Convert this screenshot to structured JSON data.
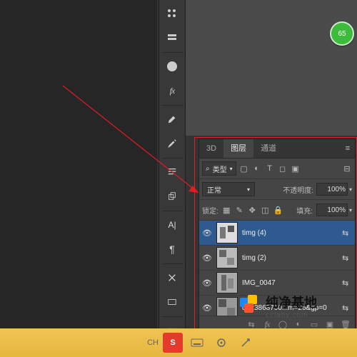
{
  "badge": "65",
  "sidebar_icons": [
    "swatches",
    "history",
    "adjustments",
    "styles",
    "brush",
    "brush-presets",
    "paragraph",
    "clone",
    "character",
    "notes",
    "tools",
    "view",
    "timeline"
  ],
  "panel": {
    "tabs": {
      "t3d": "3D",
      "layers": "图层",
      "channels": "通道"
    },
    "filter": {
      "search": "⌕",
      "type_label": "类型"
    },
    "blend": {
      "mode": "正常",
      "opacity_label": "不透明度:",
      "opacity": "100%"
    },
    "lock": {
      "label": "锁定:",
      "fill_label": "填充:",
      "fill": "100%"
    },
    "layers": [
      {
        "name": "timg (4)",
        "selected": true,
        "linked": true
      },
      {
        "name": "timg (2)",
        "selected": false,
        "linked": true
      },
      {
        "name": "IMG_0047",
        "selected": false,
        "linked": true
      },
      {
        "name": "u=23868700...m=26&gp=0",
        "selected": false,
        "linked": true
      }
    ]
  },
  "taskbar": {
    "lang": "CH"
  },
  "watermark": {
    "title": "纯净基地",
    "sub": "czlaby.com"
  }
}
